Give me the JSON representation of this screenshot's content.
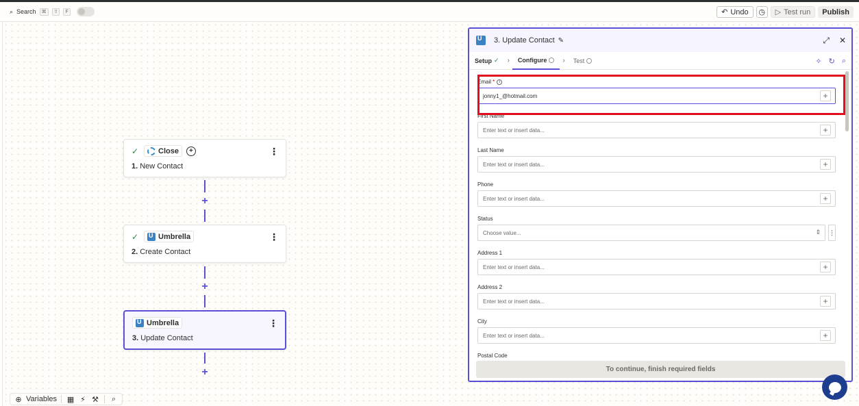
{
  "topbar": {
    "search_label": "Search",
    "shortcut_keys": [
      "⌘",
      "⇧",
      "F"
    ],
    "undo_label": "Undo",
    "test_run_label": "Test run",
    "publish_label": "Publish"
  },
  "canvas": {
    "steps": [
      {
        "app": "Close",
        "number": "1.",
        "name": "New Contact",
        "status": "done"
      },
      {
        "app": "Umbrella",
        "number": "2.",
        "name": "Create Contact",
        "status": "done"
      },
      {
        "app": "Umbrella",
        "number": "3.",
        "name": "Update Contact",
        "status": "selected"
      }
    ]
  },
  "bottom_tools": {
    "variables_label": "Variables"
  },
  "panel": {
    "title": "3. Update Contact",
    "tabs": [
      {
        "label": "Setup",
        "state": "done"
      },
      {
        "label": "Configure",
        "state": "active"
      },
      {
        "label": "Test",
        "state": "pending"
      }
    ],
    "fields": [
      {
        "label": "Email",
        "required": true,
        "value": "jonny1_@hotmail.com",
        "placeholder": ""
      },
      {
        "label": "First Name",
        "required": false,
        "value": "",
        "placeholder": "Enter text or insert data..."
      },
      {
        "label": "Last Name",
        "required": false,
        "value": "",
        "placeholder": "Enter text or insert data..."
      },
      {
        "label": "Phone",
        "required": false,
        "value": "",
        "placeholder": "Enter text or insert data..."
      },
      {
        "label": "Status",
        "required": false,
        "value": "",
        "placeholder": "Choose value..."
      },
      {
        "label": "Address 1",
        "required": false,
        "value": "",
        "placeholder": "Enter text or insert data..."
      },
      {
        "label": "Address 2",
        "required": false,
        "value": "",
        "placeholder": "Enter text or insert data..."
      },
      {
        "label": "City",
        "required": false,
        "value": "",
        "placeholder": "Enter text or insert data..."
      },
      {
        "label": "Postal Code",
        "required": false,
        "value": "",
        "placeholder": ""
      }
    ],
    "continue_label": "To continue, finish required fields"
  },
  "colors": {
    "accent": "#5b4fd6",
    "highlight": "#e0101a",
    "success": "#2e8540",
    "chat": "#1d3d8e"
  }
}
